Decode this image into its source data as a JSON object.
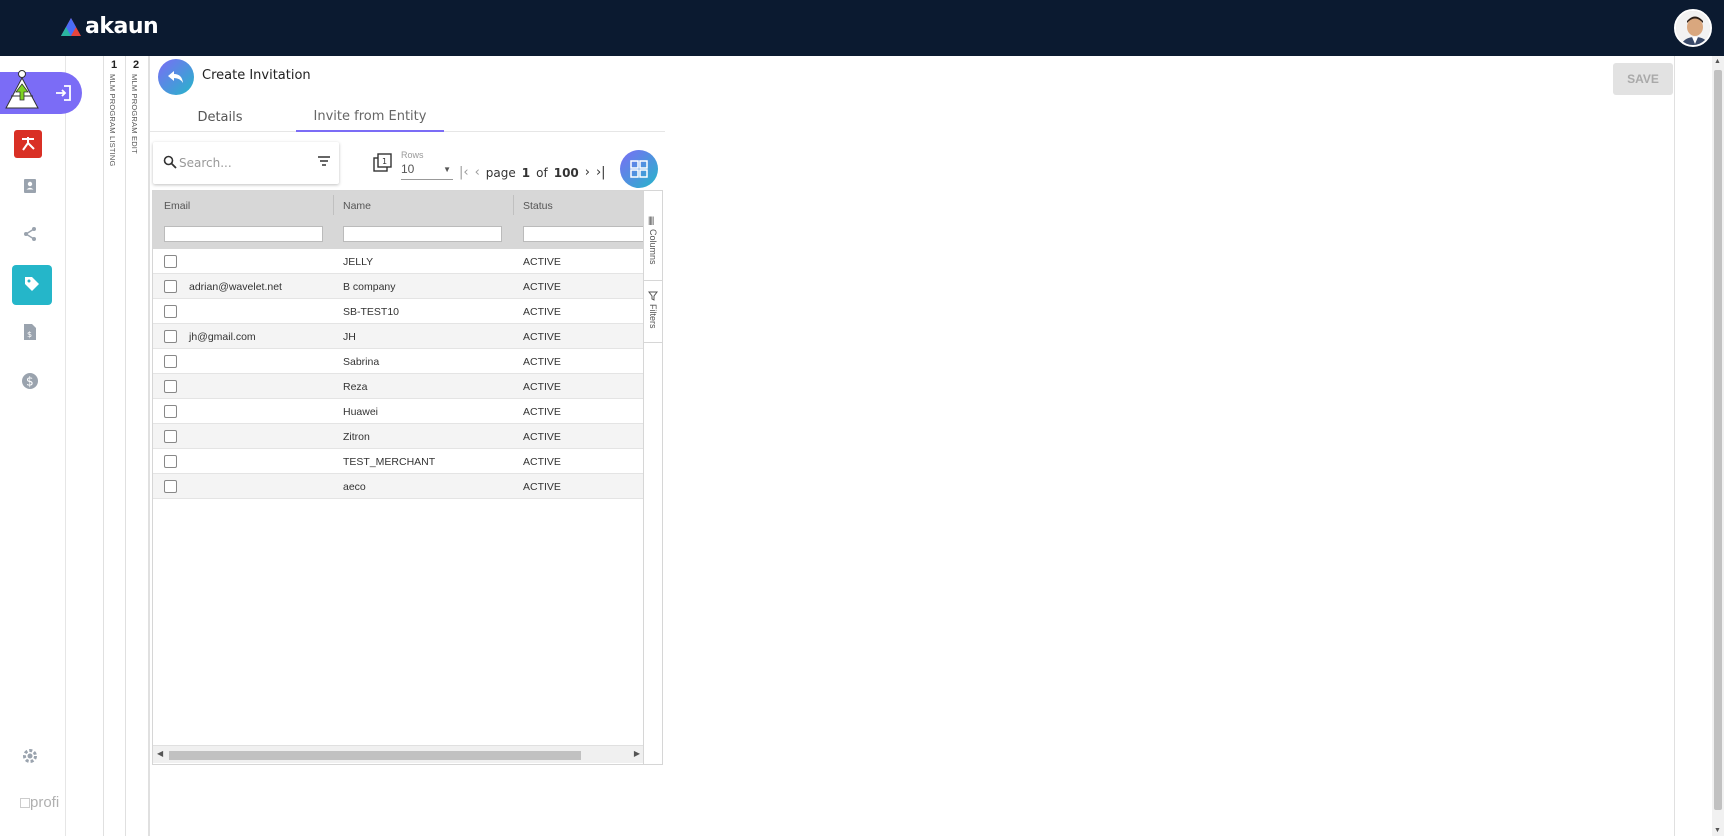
{
  "app": {
    "brand": "akaun"
  },
  "sidebar": {
    "items": [
      {
        "icon": "mlm-pyramid-icon"
      },
      {
        "icon": "logout-icon"
      },
      {
        "icon": "app-logo-icon"
      },
      {
        "icon": "contacts-icon"
      },
      {
        "icon": "share-icon"
      },
      {
        "icon": "tag-icon"
      },
      {
        "icon": "invoice-icon"
      },
      {
        "icon": "dollar-icon"
      },
      {
        "icon": "gear-icon"
      }
    ],
    "broken_image_alt": "profi"
  },
  "breadcrumbs": [
    {
      "number": "1",
      "label": "MLM PROGRAM LISTING"
    },
    {
      "number": "2",
      "label": "MLM PROGRAM EDIT"
    }
  ],
  "header": {
    "title": "Create Invitation",
    "save_label": "SAVE"
  },
  "tabs": [
    {
      "label": "Details",
      "active": false
    },
    {
      "label": "Invite from Entity",
      "active": true
    }
  ],
  "toolbar": {
    "search_placeholder": "Search...",
    "rows_label": "Rows",
    "rows_value": "10",
    "page_word": "page",
    "page_current": "1",
    "of_word": "of",
    "page_total": "100"
  },
  "grid": {
    "columns": [
      "Email",
      "Name",
      "Status"
    ],
    "rows": [
      {
        "email": "",
        "name": "JELLY",
        "status": "ACTIVE"
      },
      {
        "email": "adrian@wavelet.net",
        "name": "B company",
        "status": "ACTIVE"
      },
      {
        "email": "",
        "name": "SB-TEST10",
        "status": "ACTIVE"
      },
      {
        "email": "jh@gmail.com",
        "name": "JH",
        "status": "ACTIVE"
      },
      {
        "email": "",
        "name": "Sabrina",
        "status": "ACTIVE"
      },
      {
        "email": "",
        "name": "Reza",
        "status": "ACTIVE"
      },
      {
        "email": "",
        "name": "Huawei",
        "status": "ACTIVE"
      },
      {
        "email": "",
        "name": "Zitron",
        "status": "ACTIVE"
      },
      {
        "email": "",
        "name": "TEST_MERCHANT",
        "status": "ACTIVE"
      },
      {
        "email": "",
        "name": "aeco",
        "status": "ACTIVE"
      }
    ],
    "side_tabs": [
      "Columns",
      "Filters"
    ]
  },
  "colors": {
    "topbar": "#0b1a30",
    "accent_purple": "#7b6cf6",
    "accent_teal": "#25b6c9"
  }
}
